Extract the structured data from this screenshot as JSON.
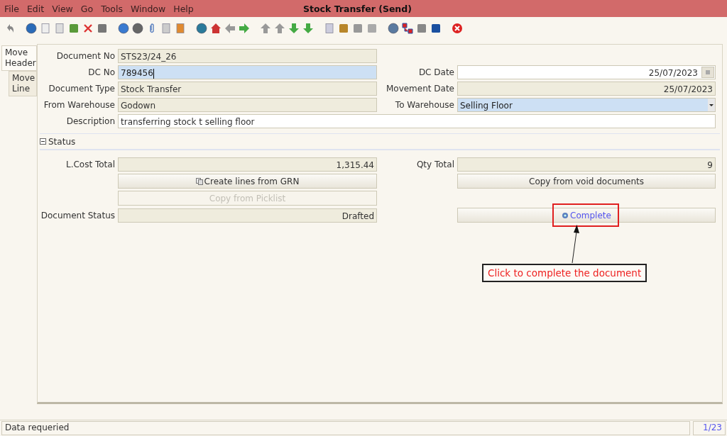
{
  "window": {
    "title": "Stock Transfer (Send)"
  },
  "menu": [
    {
      "label": "File"
    },
    {
      "label": "Edit"
    },
    {
      "label": "View"
    },
    {
      "label": "Go"
    },
    {
      "label": "Tools"
    },
    {
      "label": "Window"
    },
    {
      "label": "Help"
    }
  ],
  "tabs": [
    {
      "label": "Move Header",
      "selected": true
    },
    {
      "label": "Move Line",
      "selected": false
    }
  ],
  "header_rows": [
    {
      "kind": "pair",
      "left": {
        "label": "Document No",
        "value": "STS23/24_26",
        "kind": "readonly"
      }
    },
    {
      "kind": "pair",
      "left": {
        "label": "DC No",
        "value": "789456",
        "kind": "focused"
      },
      "right": {
        "label": "DC Date",
        "value": "25/07/2023",
        "kind": "date"
      }
    },
    {
      "kind": "pair",
      "left": {
        "label": "Document Type",
        "value": "Stock Transfer",
        "kind": "readonly"
      },
      "right": {
        "label": "Movement Date",
        "value": "25/07/2023",
        "kind": "readonly-right"
      }
    },
    {
      "kind": "pair",
      "left": {
        "label": "From Warehouse",
        "value": "Godown",
        "kind": "readonly"
      },
      "right": {
        "label": "To Warehouse",
        "value": "Selling Floor",
        "kind": "select"
      }
    },
    {
      "kind": "wide",
      "left": {
        "label": "Description",
        "value": "transferring stock t selling floor",
        "kind": "input"
      }
    }
  ],
  "status_section": {
    "title": "Status",
    "expanded": true
  },
  "status_rows": [
    {
      "left": {
        "kind": "field",
        "label": "L.Cost Total",
        "value": "1,315.44"
      },
      "right": {
        "kind": "field",
        "label": "Qty Total",
        "value": "9"
      }
    },
    {
      "left": {
        "kind": "button",
        "label": "Create lines from GRN",
        "icon": true,
        "disabled": false
      },
      "right": {
        "kind": "button",
        "label": "Copy from void documents",
        "disabled": false
      }
    },
    {
      "left": {
        "kind": "button",
        "label": "Copy from Picklist",
        "disabled": true
      }
    },
    {
      "left": {
        "kind": "field",
        "label": "Document Status",
        "value": "Drafted"
      },
      "right": {
        "kind": "button",
        "label": "Complete",
        "icon": true,
        "disabled": false,
        "highlighted": true
      }
    }
  ],
  "annotation": {
    "text": "Click to complete the document"
  },
  "status_bar": {
    "message": "Data requeried",
    "record": "1/23"
  }
}
